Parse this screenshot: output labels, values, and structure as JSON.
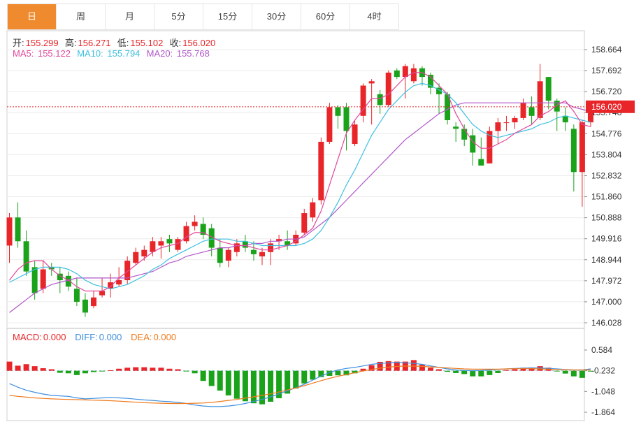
{
  "tabs": [
    {
      "label": "日",
      "active": true
    },
    {
      "label": "周",
      "active": false
    },
    {
      "label": "月",
      "active": false
    },
    {
      "label": "5分",
      "active": false
    },
    {
      "label": "15分",
      "active": false
    },
    {
      "label": "30分",
      "active": false
    },
    {
      "label": "60分",
      "active": false
    },
    {
      "label": "4时",
      "active": false
    }
  ],
  "ohlc_info": {
    "open_label": "开:",
    "open": "155.299",
    "high_label": "高:",
    "high": "156.271",
    "low_label": "低:",
    "low": "155.102",
    "close_label": "收:",
    "close": "156.020"
  },
  "ma_info": {
    "ma5_label": "MA5:",
    "ma5": "155.122",
    "ma10_label": "MA10:",
    "ma10": "155.794",
    "ma20_label": "MA20:",
    "ma20": "155.768"
  },
  "macd_info": {
    "macd_label": "MACD:",
    "macd": "0.000",
    "diff_label": "DIFF:",
    "diff": "0.000",
    "dea_label": "DEA:",
    "dea": "0.000"
  },
  "colors": {
    "up": "#e8262a",
    "down": "#1aa31a",
    "ma5": "#e0479b",
    "ma10": "#3dc0e0",
    "ma20": "#b157c9",
    "diff": "#3d8fe0",
    "dea": "#f07b1e",
    "price_tag": "#e8262a",
    "tab_active": "#f08a2e"
  },
  "chart_data": [
    {
      "type": "candlestick",
      "title": "",
      "y_ticks": [
        "158.664",
        "157.692",
        "156.720",
        "155.748",
        "154.776",
        "153.804",
        "152.832",
        "151.860",
        "150.888",
        "149.916",
        "148.944",
        "147.972",
        "147.000",
        "146.028"
      ],
      "ylim": [
        146.028,
        158.664
      ],
      "last_price": "156.020",
      "candles": [
        [
          149.6,
          150.9,
          151.1,
          148.8
        ],
        [
          150.9,
          149.8,
          151.6,
          149.5
        ],
        [
          149.8,
          148.4,
          150.3,
          148.2
        ],
        [
          148.6,
          147.4,
          148.9,
          147.1
        ],
        [
          147.6,
          148.5,
          148.9,
          147.4
        ],
        [
          148.6,
          148.5,
          148.8,
          148.2
        ],
        [
          148.3,
          148.0,
          148.6,
          147.4
        ],
        [
          148.2,
          147.7,
          148.4,
          147.5
        ],
        [
          147.6,
          147.0,
          148.1,
          146.8
        ],
        [
          147.1,
          146.5,
          147.4,
          146.3
        ],
        [
          146.8,
          147.2,
          147.5,
          146.7
        ],
        [
          147.3,
          147.5,
          148.1,
          147.2
        ],
        [
          147.6,
          147.9,
          148.3,
          147.2
        ],
        [
          147.8,
          148.0,
          148.6,
          147.7
        ],
        [
          148.0,
          148.9,
          149.1,
          147.8
        ],
        [
          148.8,
          149.3,
          149.5,
          148.7
        ],
        [
          149.1,
          149.4,
          149.6,
          148.9
        ],
        [
          149.3,
          149.8,
          150.0,
          149.1
        ],
        [
          149.6,
          149.8,
          150.0,
          149.0
        ],
        [
          149.9,
          149.7,
          150.1,
          149.3
        ],
        [
          149.4,
          149.9,
          150.0,
          149.3
        ],
        [
          149.8,
          150.5,
          150.7,
          149.7
        ],
        [
          150.5,
          150.7,
          151.0,
          150.3
        ],
        [
          150.6,
          150.1,
          150.9,
          149.9
        ],
        [
          150.4,
          149.5,
          150.6,
          149.1
        ],
        [
          149.5,
          148.8,
          149.9,
          148.6
        ],
        [
          148.9,
          149.4,
          149.5,
          148.6
        ],
        [
          149.3,
          149.7,
          149.9,
          149.1
        ],
        [
          149.8,
          149.5,
          150.1,
          149.3
        ],
        [
          149.4,
          149.2,
          149.8,
          148.9
        ],
        [
          149.1,
          149.3,
          149.5,
          148.7
        ],
        [
          149.3,
          149.7,
          149.9,
          148.7
        ],
        [
          149.8,
          149.9,
          150.1,
          149.4
        ],
        [
          149.8,
          149.6,
          150.3,
          149.4
        ],
        [
          149.7,
          150.1,
          150.3,
          149.6
        ],
        [
          150.2,
          151.1,
          151.3,
          150.1
        ],
        [
          150.9,
          151.6,
          151.8,
          150.7
        ],
        [
          151.7,
          154.4,
          154.6,
          151.5
        ],
        [
          154.4,
          156.0,
          156.2,
          154.3
        ],
        [
          156.0,
          155.6,
          156.1,
          155.0
        ],
        [
          156.0,
          154.9,
          156.2,
          154.0
        ],
        [
          154.3,
          155.2,
          155.4,
          154.2
        ],
        [
          155.6,
          157.0,
          157.1,
          155.3
        ],
        [
          157.1,
          157.2,
          157.3,
          155.2
        ],
        [
          156.6,
          156.1,
          156.8,
          155.7
        ],
        [
          156.1,
          157.6,
          157.7,
          156.0
        ],
        [
          157.7,
          157.4,
          157.8,
          157.3
        ],
        [
          157.4,
          157.9,
          158.0,
          156.4
        ],
        [
          157.2,
          157.8,
          158.0,
          157.1
        ],
        [
          157.8,
          157.4,
          157.9,
          157.0
        ],
        [
          157.5,
          156.9,
          157.6,
          156.6
        ],
        [
          156.9,
          156.6,
          157.1,
          155.7
        ],
        [
          156.6,
          155.4,
          156.7,
          155.2
        ],
        [
          155.1,
          155.0,
          155.3,
          154.4
        ],
        [
          155.0,
          154.5,
          155.2,
          154.2
        ],
        [
          154.7,
          153.9,
          155.0,
          153.3
        ],
        [
          153.6,
          153.3,
          154.6,
          153.4
        ],
        [
          153.4,
          154.9,
          155.1,
          153.5
        ],
        [
          154.9,
          155.3,
          155.5,
          154.3
        ],
        [
          155.3,
          155.3,
          155.6,
          154.9
        ],
        [
          155.3,
          155.5,
          155.6,
          155.0
        ],
        [
          155.5,
          156.2,
          156.4,
          155.4
        ],
        [
          156.0,
          155.6,
          156.5,
          155.2
        ],
        [
          155.5,
          157.2,
          158.0,
          155.4
        ],
        [
          157.4,
          156.3,
          157.4,
          155.9
        ],
        [
          156.3,
          155.8,
          156.4,
          154.9
        ],
        [
          155.6,
          155.3,
          156.0,
          154.9
        ],
        [
          155.0,
          153.0,
          155.2,
          152.1
        ],
        [
          153.0,
          155.3,
          155.4,
          151.4
        ],
        [
          155.3,
          156.0,
          156.3,
          155.1
        ]
      ],
      "ma5": [
        148.0,
        148.5,
        148.8,
        148.9,
        148.9,
        148.5,
        148.2,
        148.0,
        147.7,
        147.5,
        147.5,
        147.5,
        147.7,
        148.1,
        148.4,
        148.7,
        149.0,
        149.3,
        149.5,
        149.6,
        149.7,
        150.0,
        150.2,
        150.2,
        150.0,
        149.8,
        149.7,
        149.6,
        149.6,
        149.5,
        149.4,
        149.4,
        149.5,
        149.6,
        149.8,
        150.1,
        150.4,
        151.2,
        152.4,
        153.6,
        154.8,
        155.4,
        155.9,
        156.4,
        156.4,
        156.6,
        157.0,
        157.4,
        157.6,
        157.6,
        157.4,
        157.0,
        156.6,
        155.7,
        155.0,
        154.4,
        154.1,
        154.1,
        154.3,
        154.5,
        154.8,
        155.0,
        155.2,
        155.6,
        155.8,
        156.1,
        156.3,
        155.8,
        155.2,
        155.1
      ],
      "ma10": [
        147.9,
        148.1,
        148.3,
        148.5,
        148.6,
        148.6,
        148.6,
        148.5,
        148.3,
        148.0,
        147.8,
        147.7,
        147.6,
        147.7,
        147.8,
        148.0,
        148.2,
        148.5,
        148.7,
        149.0,
        149.2,
        149.4,
        149.6,
        149.8,
        149.9,
        149.9,
        149.9,
        149.8,
        149.8,
        149.7,
        149.6,
        149.6,
        149.6,
        149.6,
        149.6,
        149.7,
        149.9,
        150.3,
        150.9,
        151.6,
        152.4,
        153.1,
        153.9,
        154.7,
        155.3,
        155.9,
        156.3,
        156.7,
        157.0,
        157.1,
        157.0,
        156.8,
        156.6,
        156.2,
        155.7,
        155.2,
        154.9,
        154.7,
        154.6,
        154.7,
        154.8,
        154.9,
        155.0,
        155.2,
        155.3,
        155.5,
        155.6,
        155.5,
        155.4,
        155.3
      ],
      "ma20": [
        146.5,
        146.8,
        147.1,
        147.4,
        147.6,
        147.8,
        147.9,
        148.0,
        148.1,
        148.1,
        148.1,
        148.1,
        148.1,
        148.1,
        148.1,
        148.2,
        148.3,
        148.4,
        148.6,
        148.8,
        148.9,
        149.1,
        149.2,
        149.3,
        149.4,
        149.5,
        149.5,
        149.6,
        149.6,
        149.7,
        149.7,
        149.8,
        149.8,
        149.9,
        149.9,
        150.0,
        150.3,
        150.6,
        150.9,
        151.3,
        151.7,
        152.1,
        152.5,
        152.9,
        153.3,
        153.7,
        154.1,
        154.5,
        154.8,
        155.1,
        155.4,
        155.7,
        155.9,
        156.1,
        156.2,
        156.2,
        156.2,
        156.2,
        156.2,
        156.2,
        156.2,
        156.2,
        156.2,
        156.2,
        156.2,
        156.2,
        156.2,
        156.0,
        155.9,
        155.8
      ]
    },
    {
      "type": "macd",
      "title": "",
      "y_ticks": [
        "0.584",
        "-0.232",
        "-1.048",
        "-1.864"
      ],
      "ylim": [
        -1.864,
        0.584
      ],
      "zero_line": -0.232,
      "macd": [
        0.36,
        0.2,
        0.26,
        0.18,
        0.1,
        0.06,
        -0.08,
        -0.1,
        -0.17,
        -0.1,
        -0.05,
        -0.02,
        0.02,
        0.08,
        0.12,
        0.14,
        0.14,
        0.12,
        0.12,
        0.08,
        0.06,
        -0.02,
        -0.1,
        -0.4,
        -0.6,
        -0.78,
        -0.97,
        -1.1,
        -1.2,
        -1.28,
        -1.32,
        -1.22,
        -1.08,
        -0.9,
        -0.7,
        -0.5,
        -0.35,
        -0.25,
        -0.2,
        -0.18,
        -0.18,
        -0.1,
        0.08,
        0.22,
        0.35,
        0.38,
        0.36,
        0.36,
        0.42,
        0.24,
        0.12,
        0.06,
        -0.04,
        -0.09,
        -0.13,
        -0.22,
        -0.22,
        -0.17,
        -0.09,
        0.03,
        0.06,
        0.12,
        0.13,
        0.18,
        0.12,
        -0.01,
        -0.11,
        -0.22,
        -0.28,
        -0.03
      ],
      "diff": [
        -0.74,
        -0.88,
        -1.0,
        -1.08,
        -1.15,
        -1.2,
        -1.22,
        -1.24,
        -1.3,
        -1.34,
        -1.32,
        -1.3,
        -1.28,
        -1.3,
        -1.32,
        -1.35,
        -1.38,
        -1.4,
        -1.43,
        -1.45,
        -1.48,
        -1.52,
        -1.58,
        -1.62,
        -1.64,
        -1.64,
        -1.62,
        -1.58,
        -1.52,
        -1.44,
        -1.36,
        -1.26,
        -1.14,
        -1.02,
        -0.9,
        -0.76,
        -0.6,
        -0.44,
        -0.3,
        -0.2,
        -0.14,
        -0.1,
        -0.04,
        0.02,
        0.06,
        0.08,
        0.1,
        0.08,
        0.06,
        0.02,
        -0.04,
        -0.1,
        -0.16,
        -0.2,
        -0.22,
        -0.23,
        -0.22,
        -0.2,
        -0.18,
        -0.16,
        -0.14,
        -0.13,
        -0.12,
        -0.12,
        -0.14,
        -0.16,
        -0.18,
        -0.2,
        -0.2,
        -0.16
      ],
      "dea": [
        -1.2,
        -1.24,
        -1.27,
        -1.3,
        -1.32,
        -1.34,
        -1.35,
        -1.36,
        -1.37,
        -1.38,
        -1.39,
        -1.4,
        -1.41,
        -1.43,
        -1.45,
        -1.47,
        -1.49,
        -1.5,
        -1.51,
        -1.52,
        -1.52,
        -1.52,
        -1.51,
        -1.5,
        -1.48,
        -1.44,
        -1.4,
        -1.36,
        -1.31,
        -1.26,
        -1.2,
        -1.14,
        -1.07,
        -0.99,
        -0.91,
        -0.82,
        -0.72,
        -0.62,
        -0.53,
        -0.45,
        -0.38,
        -0.31,
        -0.24,
        -0.18,
        -0.13,
        -0.09,
        -0.06,
        -0.05,
        -0.05,
        -0.06,
        -0.08,
        -0.1,
        -0.12,
        -0.14,
        -0.16,
        -0.17,
        -0.17,
        -0.17,
        -0.17,
        -0.16,
        -0.15,
        -0.15,
        -0.15,
        -0.16,
        -0.17,
        -0.18,
        -0.19,
        -0.2,
        -0.2,
        -0.2
      ]
    }
  ]
}
